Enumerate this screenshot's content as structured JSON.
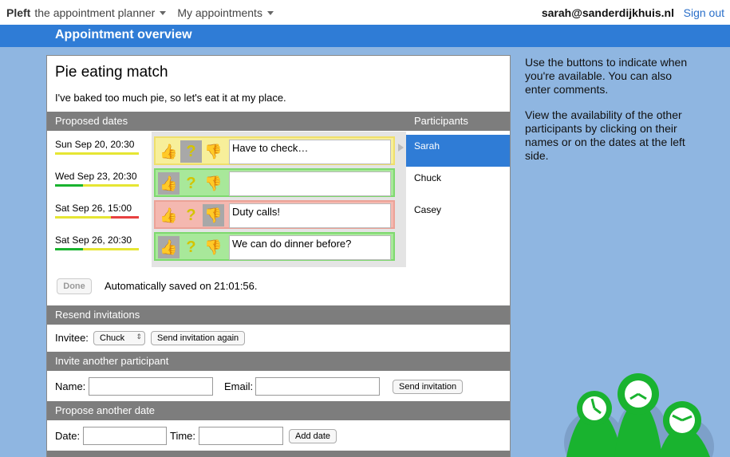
{
  "topbar": {
    "brand": "Pleft",
    "brand_sub": "the appointment planner",
    "menu": "My appointments",
    "email": "sarah@sanderdijkhuis.nl",
    "signout": "Sign out"
  },
  "page_title": "Appointment overview",
  "appointment": {
    "title": "Pie eating match",
    "description": "I've baked too much pie, so let's eat it at my place."
  },
  "sections": {
    "proposed_dates": "Proposed dates",
    "participants": "Participants",
    "resend": "Resend invitations",
    "invite": "Invite another participant",
    "propose": "Propose another date"
  },
  "dates": [
    {
      "label": "Sun Sep 20, 20:30",
      "vote": "up",
      "comment": "Have to check…",
      "color": "yellow",
      "avail": {
        "yes": 0,
        "maybe": 1,
        "no": 0
      }
    },
    {
      "label": "Wed Sep 23, 20:30",
      "vote": "up",
      "comment": "",
      "color": "green",
      "avail": {
        "yes": 0.33,
        "maybe": 0.67,
        "no": 0
      }
    },
    {
      "label": "Sat Sep 26, 15:00",
      "vote": "down",
      "comment": "Duty calls!",
      "color": "red",
      "avail": {
        "yes": 0,
        "maybe": 0.67,
        "no": 0.33
      }
    },
    {
      "label": "Sat Sep 26, 20:30",
      "vote": "up",
      "comment": "We can do dinner before?",
      "color": "green",
      "avail": {
        "yes": 0.33,
        "maybe": 0.67,
        "no": 0
      }
    }
  ],
  "participants": [
    "Sarah",
    "Chuck",
    "Casey"
  ],
  "selected_participant": "Sarah",
  "done_label": "Done",
  "saved_text": "Automatically saved on 21:01:56.",
  "resend": {
    "invitee_label": "Invitee:",
    "invitee_value": "Chuck",
    "button": "Send invitation again"
  },
  "invite": {
    "name_label": "Name:",
    "email_label": "Email:",
    "button": "Send invitation"
  },
  "propose": {
    "date_label": "Date:",
    "time_label": "Time:",
    "button": "Add date"
  },
  "help": {
    "p1": "Use the buttons to indicate when you're available. You can also enter comments.",
    "p2": "View the availability of the other participants by clicking on their names or on the dates at the left side."
  },
  "colors": {
    "accent": "#2f7cd6",
    "background": "#8fb6e1",
    "yes": "#19b32f",
    "maybe": "#e6e633",
    "no": "#e84040"
  }
}
